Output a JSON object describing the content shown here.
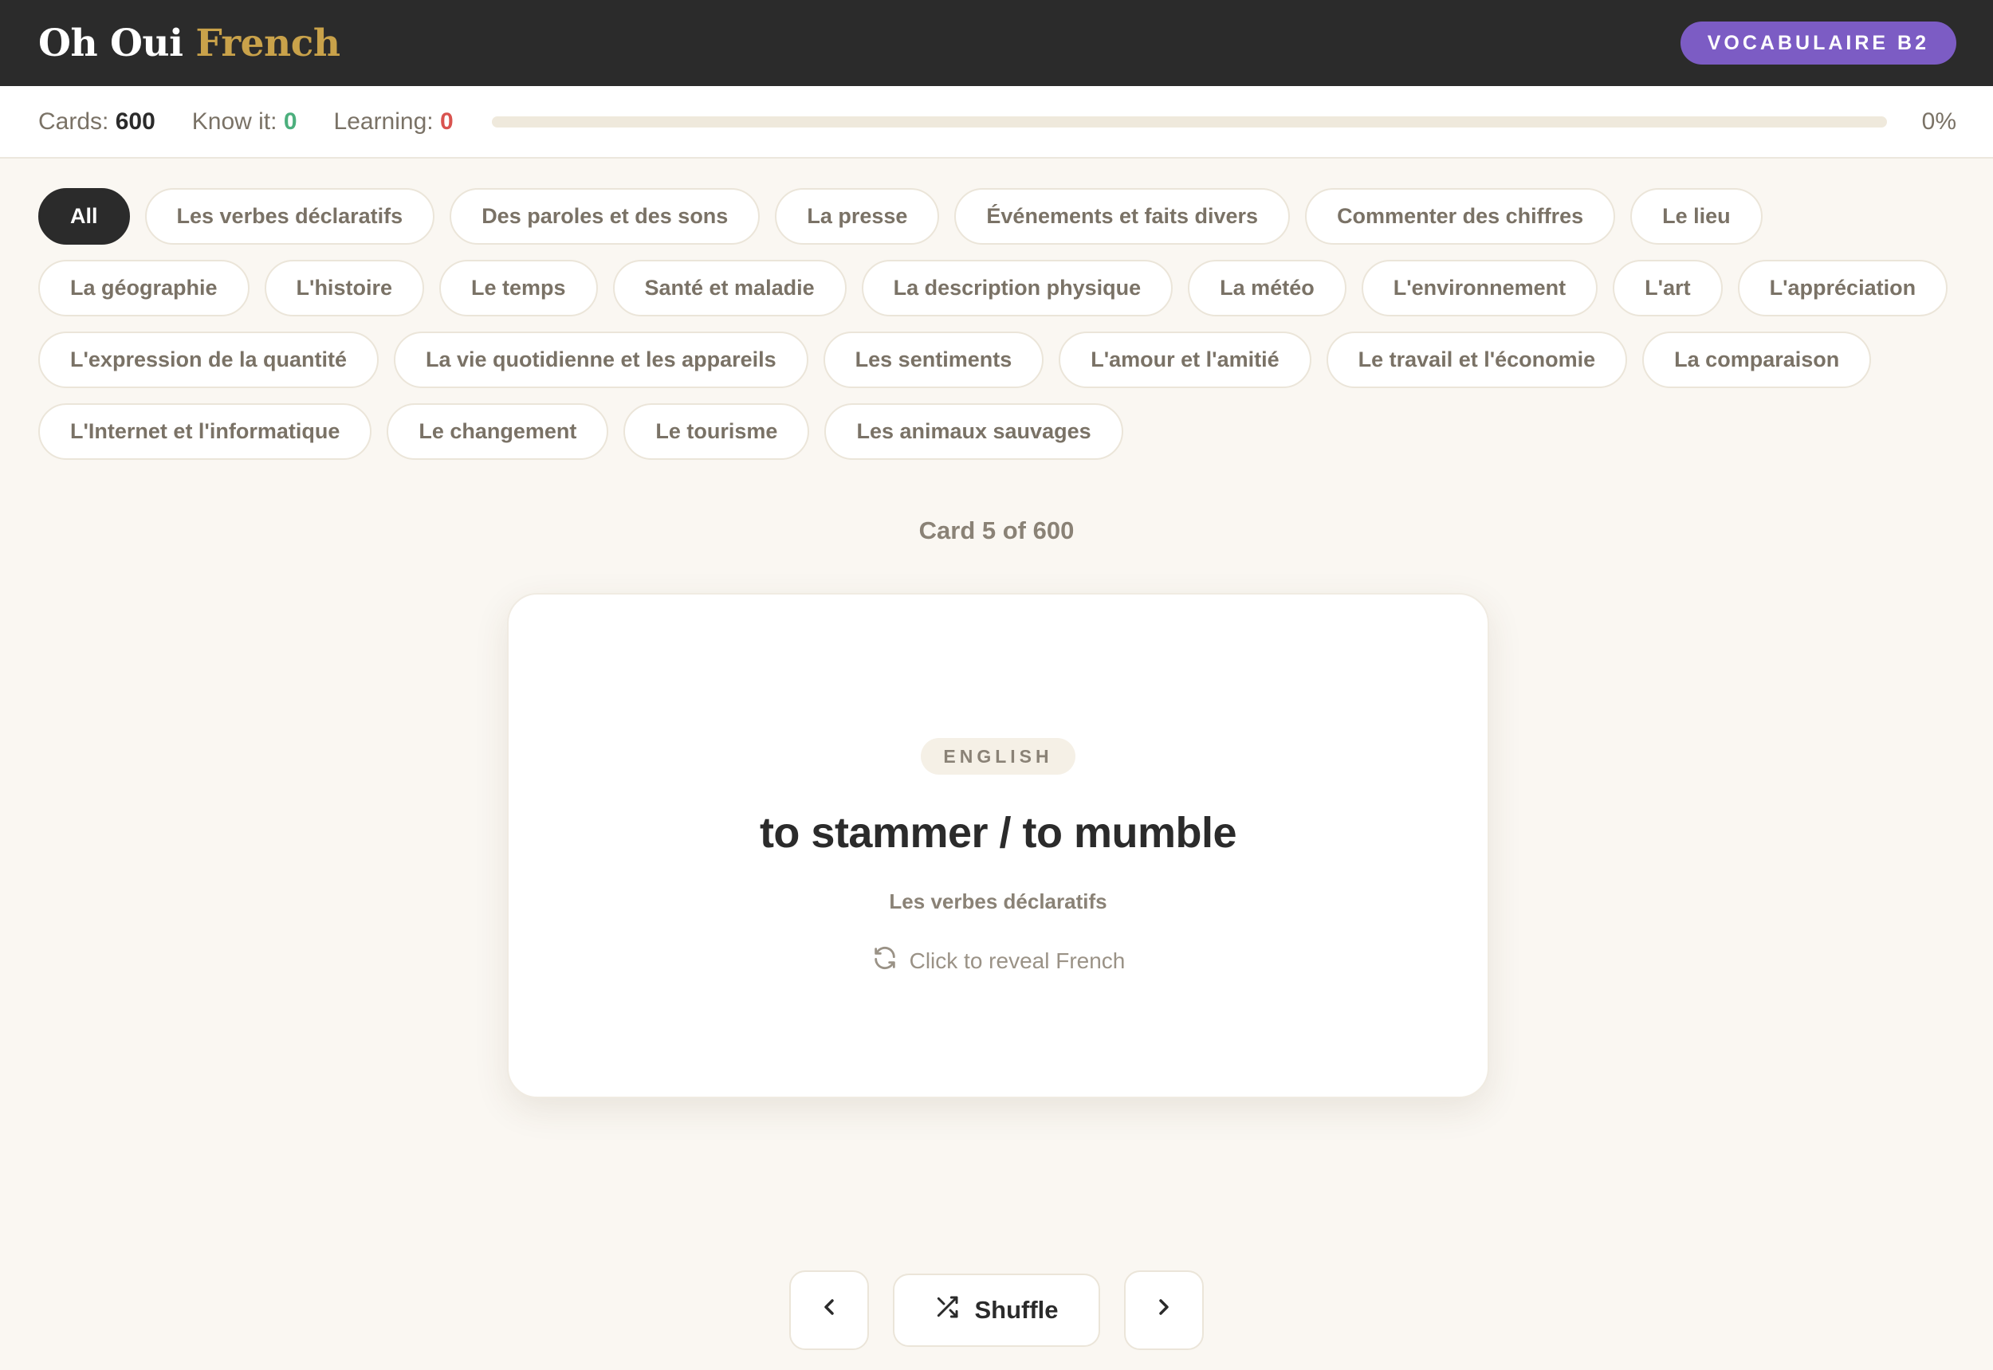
{
  "header": {
    "brand_primary": "Oh Oui",
    "brand_accent": "French",
    "level_badge": "VOCABULAIRE B2"
  },
  "stats": {
    "cards_label": "Cards:",
    "cards_value": "600",
    "know_label": "Know it:",
    "know_value": "0",
    "learning_label": "Learning:",
    "learning_value": "0",
    "progress_percent": 0,
    "progress_text": "0%"
  },
  "categories": [
    "All",
    "Les verbes déclaratifs",
    "Des paroles et des sons",
    "La presse",
    "Événements et faits divers",
    "Commenter des chiffres",
    "Le lieu",
    "La géographie",
    "L'histoire",
    "Le temps",
    "Santé et maladie",
    "La description physique",
    "La météo",
    "L'environnement",
    "L'art",
    "L'appréciation",
    "L'expression de la quantité",
    "La vie quotidienne et les appareils",
    "Les sentiments",
    "L'amour et l'amitié",
    "Le travail et l'économie",
    "La comparaison",
    "L'Internet et l'informatique",
    "Le changement",
    "Le tourisme",
    "Les animaux sauvages"
  ],
  "active_category": "All",
  "card": {
    "counter": "Card 5 of 600",
    "language_tag": "ENGLISH",
    "term": "to stammer / to mumble",
    "category": "Les verbes déclaratifs",
    "reveal_hint": "Click to reveal French"
  },
  "controls": {
    "shuffle_label": "Shuffle",
    "prev_icon": "chevron-left-icon",
    "next_icon": "chevron-right-icon",
    "shuffle_icon": "shuffle-icon",
    "reveal_icon": "refresh-icon"
  },
  "colors": {
    "header_bg": "#2b2b2b",
    "brand_accent": "#c9a24a",
    "badge": "#7c5cc4",
    "know": "#4caf7d",
    "learning": "#d9534f",
    "page_bg": "#faf7f2"
  }
}
